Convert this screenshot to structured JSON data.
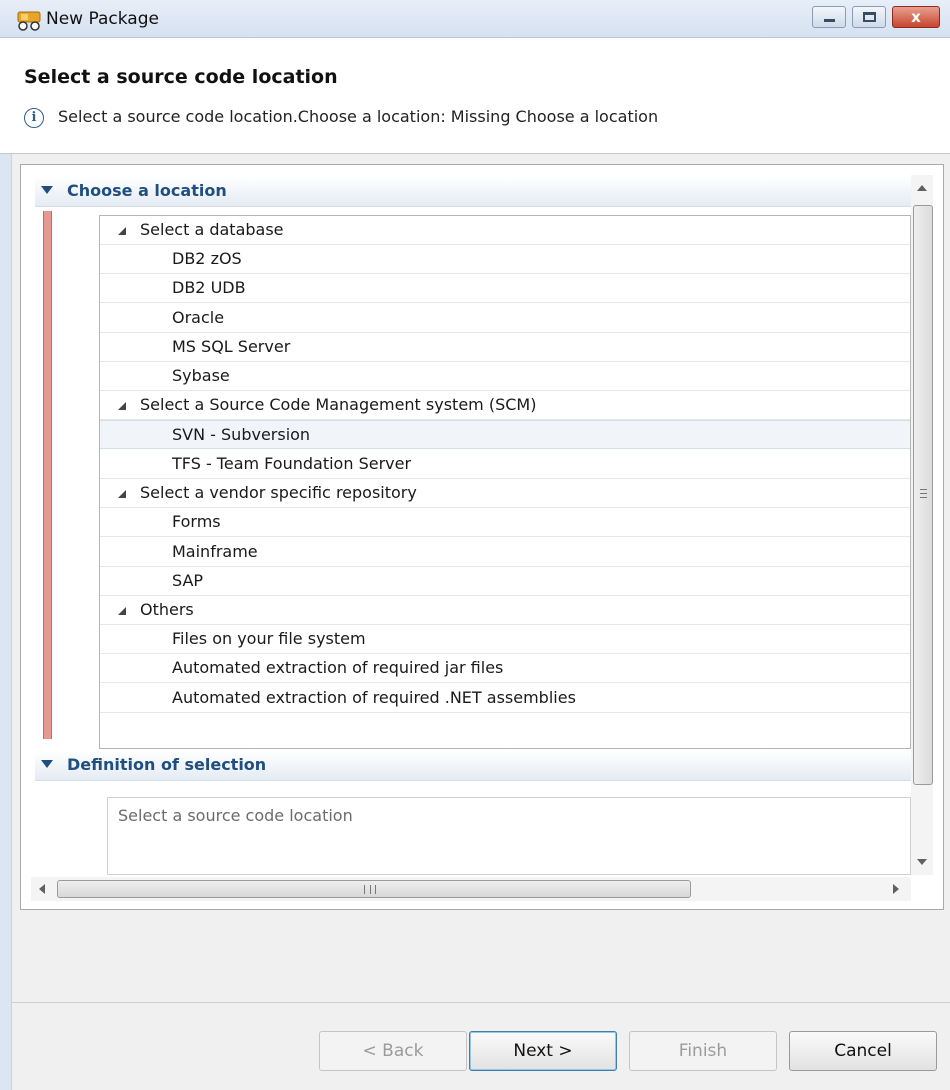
{
  "window": {
    "title": "New Package",
    "controls": {
      "close_glyph": "x"
    }
  },
  "header": {
    "heading": "Select a source code location",
    "info_icon": "info-icon",
    "info_message": "Select a source code location.Choose a location: Missing Choose a location"
  },
  "sections": {
    "choose": "Choose a location",
    "definition": "Definition of selection"
  },
  "tree": {
    "groups": [
      {
        "label": "Select a database",
        "items": [
          "DB2 zOS",
          "DB2 UDB",
          "Oracle",
          "MS SQL Server",
          "Sybase"
        ]
      },
      {
        "label": "Select a Source Code Management system (SCM)",
        "items": [
          "SVN - Subversion",
          "TFS - Team Foundation Server"
        ]
      },
      {
        "label": "Select a vendor specific repository",
        "items": [
          "Forms",
          "Mainframe",
          "SAP"
        ]
      },
      {
        "label": "Others",
        "items": [
          "Files on your file system",
          "Automated extraction of required jar files",
          "Automated extraction of required .NET assemblies"
        ]
      }
    ],
    "highlighted_item": "SVN - Subversion"
  },
  "definition": {
    "text": "Select a source code location"
  },
  "buttons": {
    "back": "< Back",
    "next": "Next >",
    "finish": "Finish",
    "cancel": "Cancel"
  },
  "colors": {
    "section_title": "#1f4e80",
    "error_bar": "#e69894",
    "title_bar": "#d6e2f1"
  }
}
